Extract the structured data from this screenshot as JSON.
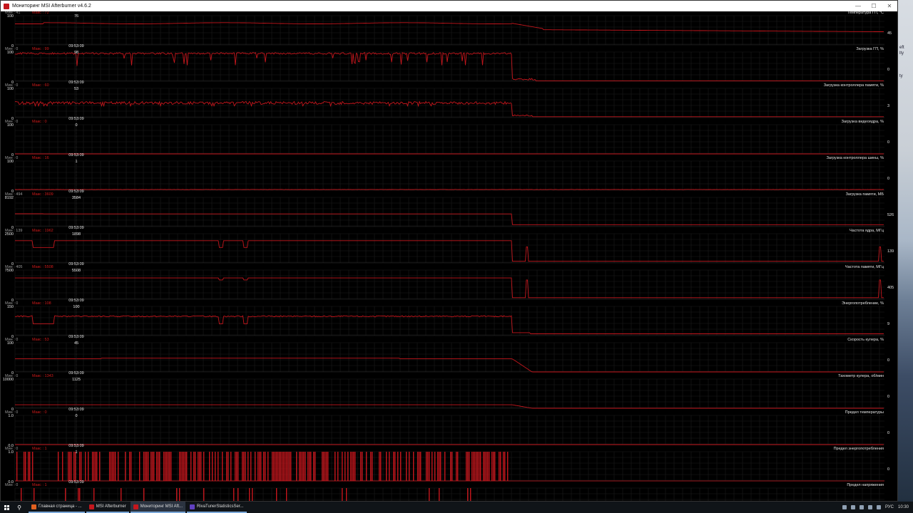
{
  "window": {
    "title": "Мониторинг MSI Afterburner v4.6.2",
    "controls": {
      "minimize": "—",
      "maximize": "☐",
      "close": "✕"
    }
  },
  "cursor_time": "09:53:09",
  "colors": {
    "line": "#c4161c",
    "grid": "#1d1d1d",
    "label": "#e6e6e6",
    "stat": "#d21a1a"
  },
  "graphs": [
    {
      "title": "Температура ГП, °С",
      "max_label": "100",
      "min_label": "0",
      "min": "Мин : 41",
      "max": "Макс : 72",
      "cursor_value": "76",
      "last_value": "45",
      "shape": "temp"
    },
    {
      "title": "Загрузка ГП, %",
      "max_label": "100",
      "min_label": "0",
      "min": "Мин : 0",
      "max": "Макс : 99",
      "cursor_value": "98",
      "last_value": "0",
      "shape": "load"
    },
    {
      "title": "Загрузка контроллера памяти, %",
      "max_label": "100",
      "min_label": "0",
      "min": "Мин : 0",
      "max": "Макс : 60",
      "cursor_value": "53",
      "last_value": "3",
      "shape": "memctrl"
    },
    {
      "title": "Загрузка видеоядра, %",
      "max_label": "100",
      "min_label": "0",
      "min": "Мин : 0",
      "max": "Макс : 0",
      "cursor_value": "0",
      "last_value": "0",
      "shape": "flat"
    },
    {
      "title": "Загрузка контроллера шины, %",
      "max_label": "100",
      "min_label": "0",
      "min": "Мин : 0",
      "max": "Макс : 16",
      "cursor_value": "1",
      "last_value": "0",
      "shape": "bus"
    },
    {
      "title": "Загрузка памяти, МБ",
      "max_label": "8192",
      "min_label": "0",
      "min": "Мин : 494",
      "max": "Макс : 3609",
      "cursor_value": "3584",
      "last_value": "526",
      "shape": "memused"
    },
    {
      "title": "Частота ядра, МГц",
      "max_label": "2500",
      "min_label": "0",
      "min": "Мин : 139",
      "max": "Макс : 1962",
      "cursor_value": "1898",
      "last_value": "139",
      "shape": "coreclk"
    },
    {
      "title": "Частота памяти, МГц",
      "max_label": "7500",
      "min_label": "0",
      "min": "Мин : 405",
      "max": "Макс : 5508",
      "cursor_value": "5508",
      "last_value": "405",
      "shape": "memclk"
    },
    {
      "title": "Энергопотребление, %",
      "max_label": "150",
      "min_label": "0",
      "min": "Мин : 0",
      "max": "Макс : 108",
      "cursor_value": "100",
      "last_value": "9",
      "shape": "power"
    },
    {
      "title": "Скорость кулера, %",
      "max_label": "100",
      "min_label": "0",
      "min": "Мин : 0",
      "max": "Макс : 53",
      "cursor_value": "45",
      "last_value": "0",
      "shape": "fan"
    },
    {
      "title": "Тахометр кулера, об/мин",
      "max_label": "10000",
      "min_label": "0",
      "min": "Мин : 0",
      "max": "Макс : 1343",
      "cursor_value": "1125",
      "last_value": "0",
      "shape": "tach"
    },
    {
      "title": "Предел температуры",
      "max_label": "1.0",
      "min_label": "0.0",
      "min": "Мин : 0",
      "max": "Макс : 0",
      "cursor_value": "0",
      "last_value": "0",
      "shape": "flat"
    },
    {
      "title": "Предел энергопотребления",
      "max_label": "1.0",
      "min_label": "0.0",
      "min": "Мин : 0",
      "max": "Макс : 1",
      "cursor_value": "1",
      "last_value": "0",
      "shape": "limit"
    },
    {
      "title": "Предел напряжения",
      "max_label": "",
      "min_label": "",
      "min": "Мин : 0",
      "max": "Макс : 1",
      "cursor_value": "",
      "last_value": "",
      "shape": "limit2"
    }
  ],
  "taskbar": {
    "items": [
      {
        "label": "Главная страница - ...",
        "color": "#e06020",
        "active": false
      },
      {
        "label": "MSI Afterburner",
        "color": "#c4161c",
        "active": false
      },
      {
        "label": "Мониторинг MSI Aft...",
        "color": "#c4161c",
        "active": true
      },
      {
        "label": "RivaTunerStatisticsSer...",
        "color": "#6040c0",
        "active": false
      }
    ],
    "lang": "РУС",
    "time": "10:30"
  },
  "wallpaper": {
    "snippets": [
      "eft",
      "lty",
      "ty"
    ]
  }
}
